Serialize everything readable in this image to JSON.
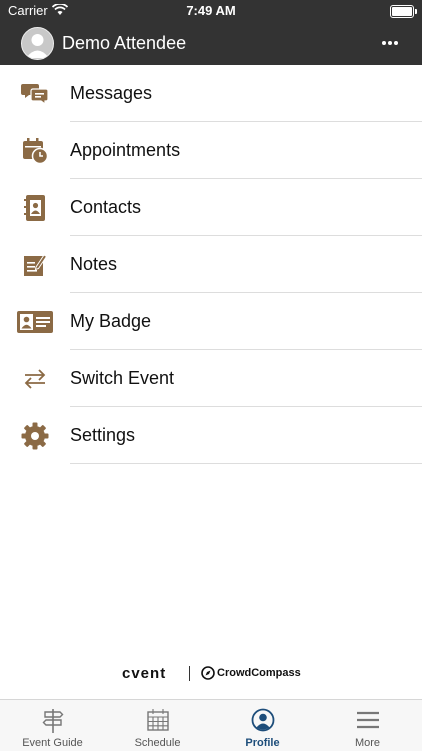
{
  "status_bar": {
    "carrier": "Carrier",
    "time": "7:49 AM"
  },
  "header": {
    "user_name": "Demo Attendee",
    "more_icon": "more-horizontal-icon"
  },
  "menu": [
    {
      "label": "Messages",
      "icon": "messages-icon"
    },
    {
      "label": "Appointments",
      "icon": "appointments-icon"
    },
    {
      "label": "Contacts",
      "icon": "contacts-icon"
    },
    {
      "label": "Notes",
      "icon": "notes-icon"
    },
    {
      "label": "My Badge",
      "icon": "badge-icon"
    },
    {
      "label": "Switch Event",
      "icon": "switch-icon"
    },
    {
      "label": "Settings",
      "icon": "gear-icon"
    }
  ],
  "branding": {
    "left": "cvent",
    "right": "CrowdCompass"
  },
  "tabs": [
    {
      "label": "Event Guide",
      "icon": "signpost-icon",
      "active": false
    },
    {
      "label": "Schedule",
      "icon": "calendar-icon",
      "active": false
    },
    {
      "label": "Profile",
      "icon": "profile-icon",
      "active": true
    },
    {
      "label": "More",
      "icon": "hamburger-icon",
      "active": false
    }
  ],
  "colors": {
    "header_bg": "#333333",
    "icon_accent": "#8b6a45",
    "active_tab": "#1d4d7a"
  }
}
